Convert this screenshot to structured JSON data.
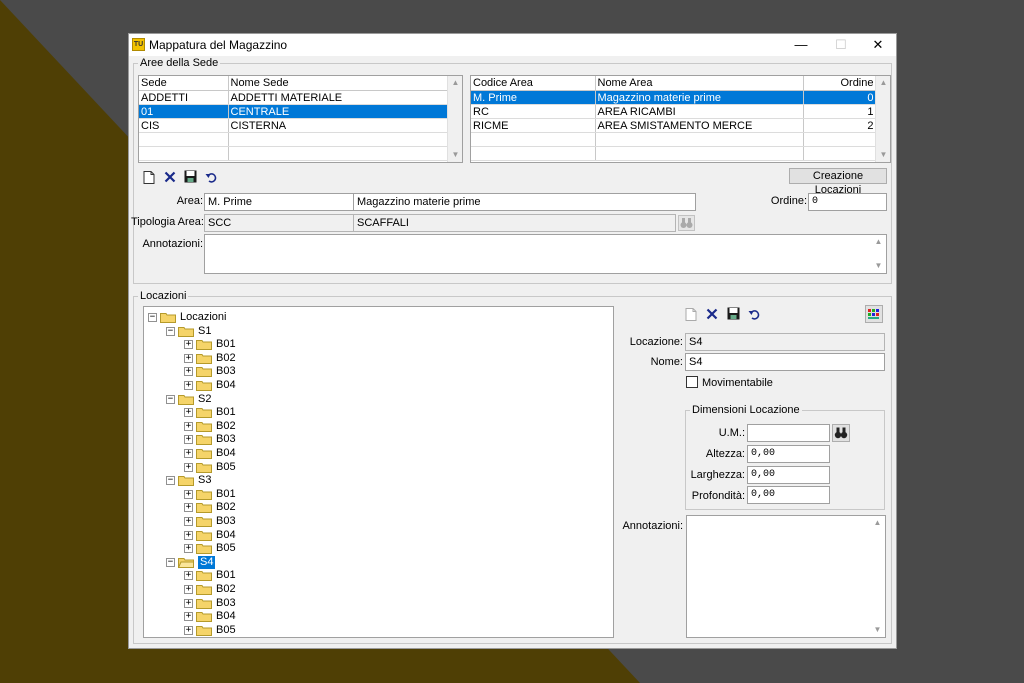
{
  "window": {
    "icon_text": "TU",
    "title": "Mappatura del Magazzino",
    "minimize": "—",
    "maximize": "☐",
    "close": "✕"
  },
  "aree_sede": {
    "group_label": "Aree della Sede",
    "sede_grid": {
      "columns": [
        "Sede",
        "Nome Sede"
      ],
      "rows": [
        [
          "ADDETTI",
          "ADDETTI MATERIALE"
        ],
        [
          "01",
          "CENTRALE"
        ],
        [
          "CIS",
          "CISTERNA"
        ]
      ],
      "selected_row": 1
    },
    "area_grid": {
      "columns": [
        "Codice Area",
        "Nome Area",
        "Ordine"
      ],
      "rows": [
        [
          "M. Prime",
          "Magazzino materie prime",
          "0"
        ],
        [
          "RC",
          "AREA RICAMBI",
          "1"
        ],
        [
          "RICME",
          "AREA SMISTAMENTO MERCE",
          "2"
        ]
      ],
      "selected_row": 0
    },
    "creazione_button": "Creazione Locazioni",
    "area_label": "Area:",
    "area_code": "M. Prime",
    "area_name": "Magazzino materie prime",
    "ordine_label": "Ordine:",
    "ordine_value": "0",
    "tipologia_label": "Tipologia Area:",
    "tipologia_code": "SCC",
    "tipologia_name": "SCAFFALI",
    "annotazioni_label": "Annotazioni:"
  },
  "locazioni": {
    "group_label": "Locazioni",
    "tree": {
      "root": "Locazioni",
      "nodes": [
        {
          "label": "S1",
          "children": [
            "B01",
            "B02",
            "B03",
            "B04"
          ]
        },
        {
          "label": "S2",
          "children": [
            "B01",
            "B02",
            "B03",
            "B04",
            "B05"
          ]
        },
        {
          "label": "S3",
          "children": [
            "B01",
            "B02",
            "B03",
            "B04",
            "B05"
          ]
        },
        {
          "label": "S4",
          "children": [
            "B01",
            "B02",
            "B03",
            "B04",
            "B05"
          ]
        }
      ],
      "selected": "S4"
    },
    "locazione_label": "Locazione:",
    "locazione_value": "S4",
    "nome_label": "Nome:",
    "nome_value": "S4",
    "movimentabile_label": "Movimentabile",
    "dimensioni_label": "Dimensioni Locazione",
    "um_label": "U.M.:",
    "um_value": "",
    "altezza_label": "Altezza:",
    "altezza_value": "0,00",
    "larghezza_label": "Larghezza:",
    "larghezza_value": "0,00",
    "profondita_label": "Profondità:",
    "profondita_value": "0,00",
    "annotazioni_label": "Annotazioni:"
  },
  "colors": {
    "selection": "#0078d7",
    "background_dark": "#4a4a4a",
    "background_gold": "#4f3f05",
    "folder": "#f5d469"
  },
  "icons": [
    "new-file-icon",
    "delete-icon",
    "save-icon",
    "undo-icon",
    "binoculars-icon",
    "grid-colors-icon"
  ]
}
